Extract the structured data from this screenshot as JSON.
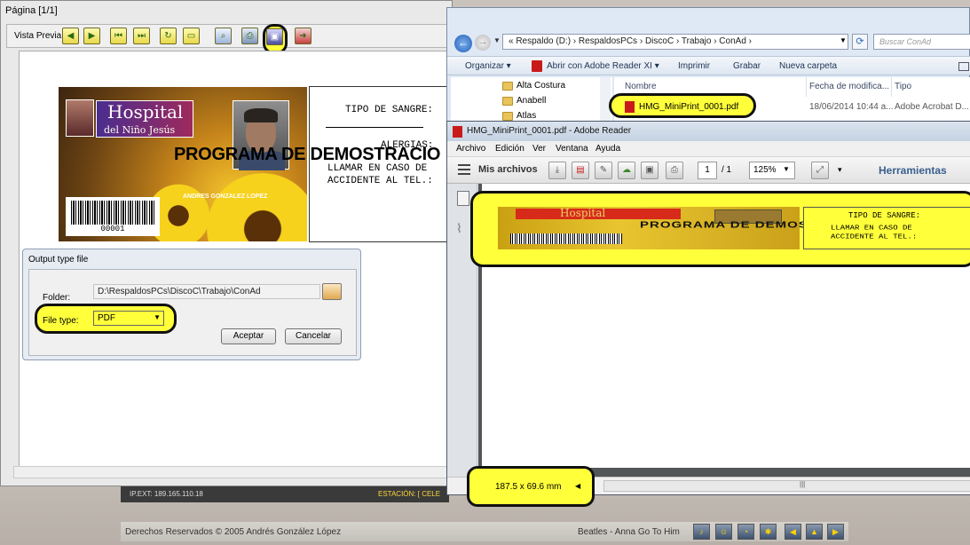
{
  "preview": {
    "title": "Página [1/1]",
    "toolbar_label": "Vista Previa"
  },
  "card": {
    "hospital_name": "Hospital",
    "hospital_sub": "del Niño Jesús",
    "demo_banner": "PROGRAMA DE DEMOSTRACIO",
    "holder_name": "ANDRES GONZALEZ LOPEZ",
    "barcode_number": "00001",
    "back_tipo": "TIPO DE SANGRE:",
    "back_alergias": "ALERGIAS:",
    "back_llamar": "LLAMAR EN CASO DE",
    "back_accidente": "ACCIDENTE AL TEL.:"
  },
  "dialog": {
    "title": "Output type file",
    "folder_label": "Folder:",
    "folder_value": "D:\\RespaldosPCs\\DiscoC\\Trabajo\\ConAd",
    "filetype_label": "File type:",
    "filetype_value": "PDF",
    "accept_label": "Aceptar",
    "cancel_label": "Cancelar"
  },
  "status": {
    "ip_text": "IP.EXT: 189.165.110.18",
    "estacion_text": "ESTACIÓN: [ CELE",
    "copyright": "Derechos Reservados © 2005 Andrés González López",
    "song": "Beatles - Anna Go To Him"
  },
  "explorer": {
    "breadcrumb": "« Respaldo (D:) › RespaldosPCs › DiscoC › Trabajo › ConAd ›",
    "search_placeholder": "Buscar ConAd",
    "commands": [
      "Organizar ▾",
      "Abrir con Adobe Reader XI ▾",
      "Imprimir",
      "Grabar",
      "Nueva carpeta"
    ],
    "tree": [
      "Alta Costura",
      "Anabell",
      "Atlas"
    ],
    "columns": [
      "Nombre",
      "Fecha de modifica...",
      "Tipo"
    ],
    "file": {
      "name": "HMG_MiniPrint_0001.pdf",
      "date": "18/06/2014 10:44 a...",
      "type": "Adobe Acrobat D..."
    }
  },
  "reader": {
    "title": "HMG_MiniPrint_0001.pdf - Adobe Reader",
    "menus": [
      "Archivo",
      "Edición",
      "Ver",
      "Ventana",
      "Ayuda"
    ],
    "mis_archivos": "Mis archivos",
    "page_current": "1",
    "page_total": "/ 1",
    "zoom": "125%",
    "herramientas": "Herramientas",
    "page_size": "187.5 x 69.6 mm",
    "mini_hospital": "Hospital",
    "mini_demo": "PROGRAMA DE DEMOSTRACIO",
    "mini_tipo": "TIPO DE SANGRE:",
    "mini_llamar": "LLAMAR EN CASO DE",
    "mini_accidente": "ACCIDENTE AL TEL.:"
  },
  "colors": {
    "highlight": "#ffff3a",
    "explorer_bg": "#dfe9f5",
    "reader_accent": "#3a5f8f"
  }
}
